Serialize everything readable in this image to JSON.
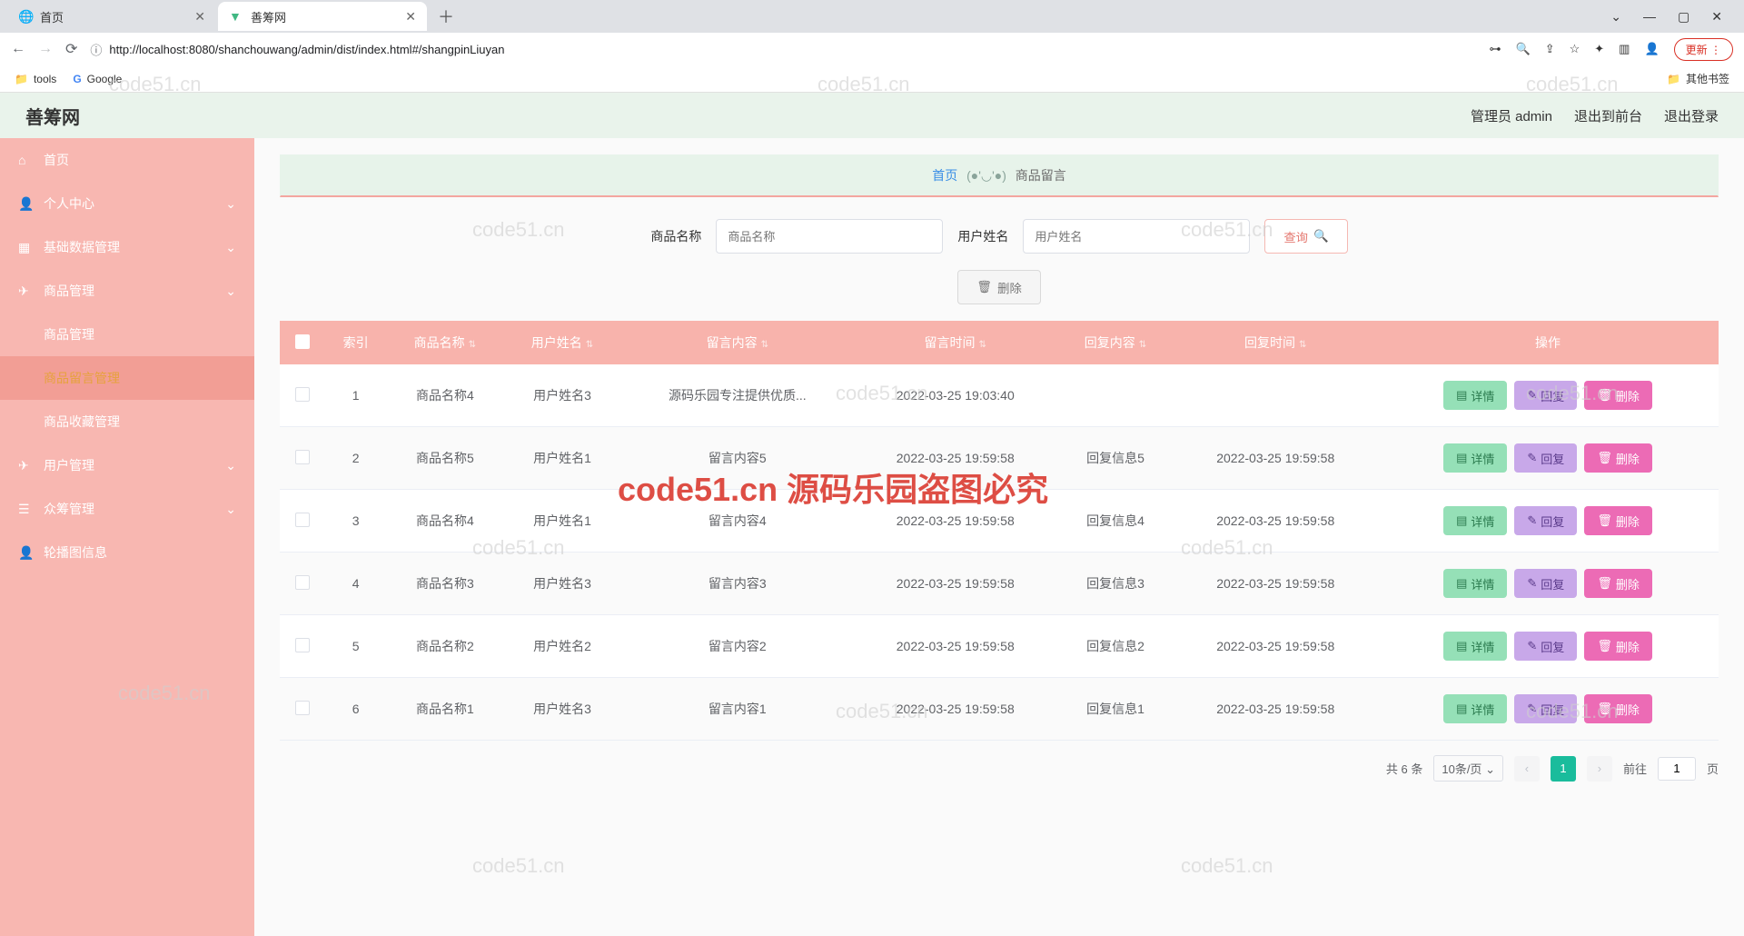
{
  "browser": {
    "tabs": [
      {
        "title": "首页",
        "active": false
      },
      {
        "title": "善筹网",
        "active": true
      }
    ],
    "url": "http://localhost:8080/shanchouwang/admin/dist/index.html#/shangpinLiuyan",
    "update_label": "更新",
    "bookmarks": {
      "tools": "tools",
      "google": "Google",
      "other": "其他书签"
    },
    "window": {
      "min": "—",
      "max": "▢",
      "close": "✕",
      "dropdown": "⌄"
    }
  },
  "header": {
    "logo": "善筹网",
    "admin_label": "管理员 admin",
    "front_label": "退出到前台",
    "logout_label": "退出登录"
  },
  "sidebar": {
    "items": [
      {
        "label": "首页",
        "icon": "home",
        "sub": false
      },
      {
        "label": "个人中心",
        "icon": "user",
        "sub": false,
        "expand": true
      },
      {
        "label": "基础数据管理",
        "icon": "grid",
        "sub": false,
        "expand": true
      },
      {
        "label": "商品管理",
        "icon": "plane",
        "sub": false,
        "expand": true
      },
      {
        "label": "商品管理",
        "icon": "",
        "sub": true
      },
      {
        "label": "商品留言管理",
        "icon": "",
        "sub": true,
        "active": true
      },
      {
        "label": "商品收藏管理",
        "icon": "",
        "sub": true
      },
      {
        "label": "用户管理",
        "icon": "plane",
        "sub": false,
        "expand": true
      },
      {
        "label": "众筹管理",
        "icon": "list",
        "sub": false,
        "expand": true
      },
      {
        "label": "轮播图信息",
        "icon": "user",
        "sub": false
      }
    ]
  },
  "breadcrumb": {
    "home": "首页",
    "face": "(●'◡'●)",
    "current": "商品留言"
  },
  "filter": {
    "product_label": "商品名称",
    "product_placeholder": "商品名称",
    "user_label": "用户姓名",
    "user_placeholder": "用户姓名",
    "query_label": "查询"
  },
  "actions": {
    "delete_label": "删除"
  },
  "table": {
    "columns": [
      "索引",
      "商品名称",
      "用户姓名",
      "留言内容",
      "留言时间",
      "回复内容",
      "回复时间",
      "操作"
    ],
    "row_actions": {
      "detail": "详情",
      "reply": "回复",
      "delete": "删除"
    },
    "rows": [
      {
        "idx": "1",
        "product": "商品名称4",
        "user": "用户姓名3",
        "msg": "源码乐园专注提供优质...",
        "msg_time": "2022-03-25 19:03:40",
        "reply": "",
        "reply_time": ""
      },
      {
        "idx": "2",
        "product": "商品名称5",
        "user": "用户姓名1",
        "msg": "留言内容5",
        "msg_time": "2022-03-25 19:59:58",
        "reply": "回复信息5",
        "reply_time": "2022-03-25 19:59:58"
      },
      {
        "idx": "3",
        "product": "商品名称4",
        "user": "用户姓名1",
        "msg": "留言内容4",
        "msg_time": "2022-03-25 19:59:58",
        "reply": "回复信息4",
        "reply_time": "2022-03-25 19:59:58"
      },
      {
        "idx": "4",
        "product": "商品名称3",
        "user": "用户姓名3",
        "msg": "留言内容3",
        "msg_time": "2022-03-25 19:59:58",
        "reply": "回复信息3",
        "reply_time": "2022-03-25 19:59:58"
      },
      {
        "idx": "5",
        "product": "商品名称2",
        "user": "用户姓名2",
        "msg": "留言内容2",
        "msg_time": "2022-03-25 19:59:58",
        "reply": "回复信息2",
        "reply_time": "2022-03-25 19:59:58"
      },
      {
        "idx": "6",
        "product": "商品名称1",
        "user": "用户姓名3",
        "msg": "留言内容1",
        "msg_time": "2022-03-25 19:59:58",
        "reply": "回复信息1",
        "reply_time": "2022-03-25 19:59:58"
      }
    ]
  },
  "pagination": {
    "total_label": "共 6 条",
    "page_size": "10条/页",
    "current": "1",
    "goto_label": "前往",
    "goto_value": "1",
    "page_suffix": "页"
  },
  "watermarks": {
    "text": "code51.cn",
    "red": "code51.cn 源码乐园盗图必究"
  }
}
